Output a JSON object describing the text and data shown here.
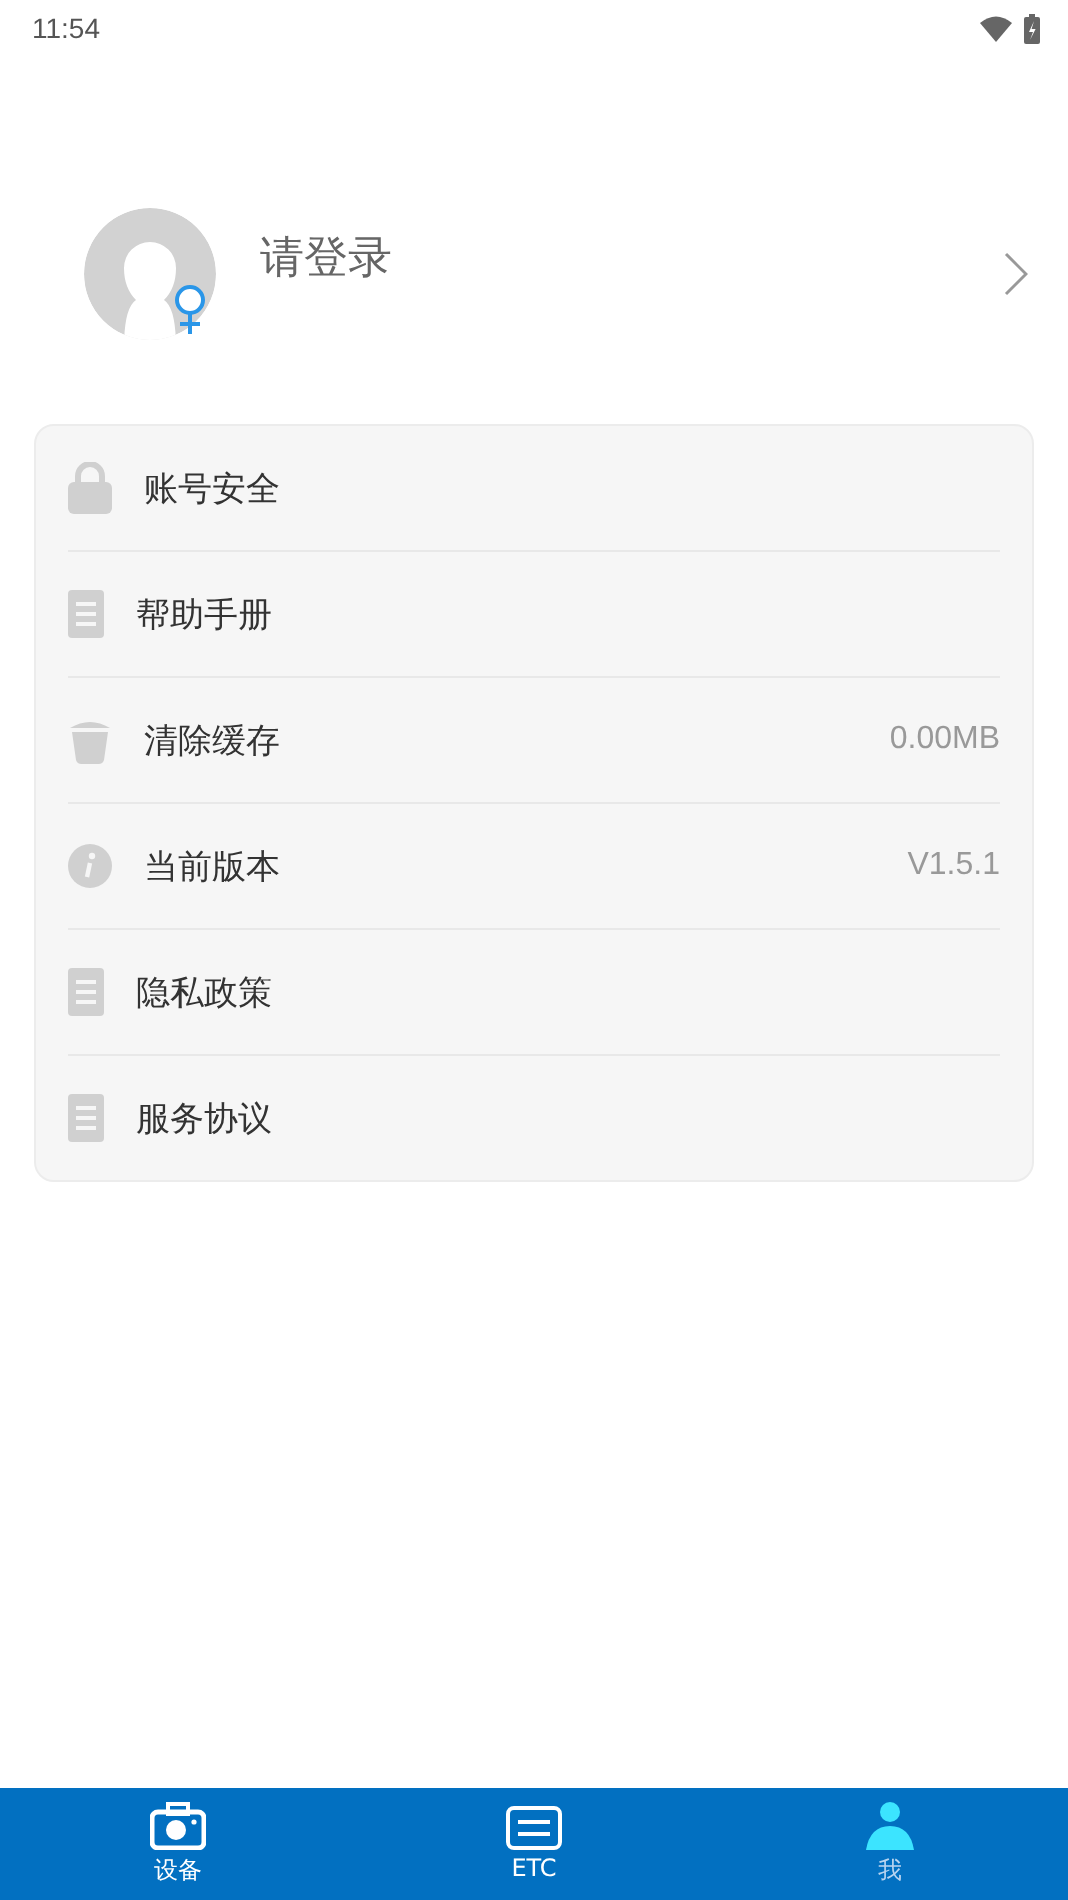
{
  "status_bar": {
    "time": "11:54"
  },
  "profile": {
    "name": "请登录",
    "female": true
  },
  "menu": [
    {
      "kind": "lock",
      "label": "账号安全"
    },
    {
      "kind": "doc",
      "label": "帮助手册"
    },
    {
      "kind": "trash",
      "label": "清除缓存",
      "value": "0.00MB"
    },
    {
      "kind": "info",
      "label": "当前版本",
      "value": "V1.5.1"
    },
    {
      "kind": "doc",
      "label": "隐私政策"
    },
    {
      "kind": "doc",
      "label": "服务协议"
    }
  ],
  "tabs": [
    {
      "kind": "camera",
      "label": "设备",
      "selected": false
    },
    {
      "kind": "etc",
      "label": "ETC",
      "selected": false
    },
    {
      "kind": "person",
      "label": "我",
      "selected": true
    }
  ]
}
